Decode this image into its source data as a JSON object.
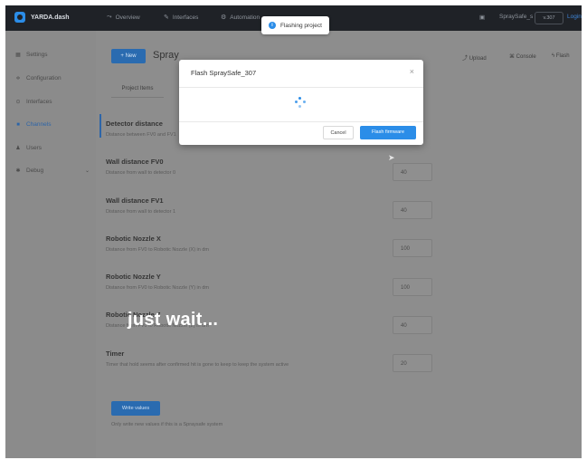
{
  "topbar": {
    "app_name": "YARDA.dash",
    "nav": [
      {
        "icon": "chart-line-icon",
        "label": "Overview"
      },
      {
        "icon": "pencil-icon",
        "label": "Interfaces"
      },
      {
        "icon": "gear-icon",
        "label": "Automation"
      }
    ],
    "user_label": "SpraySafe_s",
    "version_badge": "v.307",
    "login_label": "Login"
  },
  "toast": {
    "text": "Flashing project",
    "icon": "info-icon"
  },
  "sidebar": {
    "items": [
      {
        "icon": "grid-icon",
        "label": "Settings",
        "active": false
      },
      {
        "icon": "sliders-icon",
        "label": "Configuration",
        "active": false
      },
      {
        "icon": "plug-icon",
        "label": "Interfaces",
        "active": false
      },
      {
        "icon": "square-icon",
        "label": "Channels",
        "active": true
      },
      {
        "icon": "user-icon",
        "label": "Users",
        "active": false
      },
      {
        "icon": "bug-icon",
        "label": "Debug",
        "active": false
      }
    ]
  },
  "main": {
    "new_button": "+ New",
    "project_title": "Spray",
    "tools": [
      {
        "icon": "upload-icon",
        "label": "Upload"
      },
      {
        "icon": "terminal-icon",
        "label": "Console"
      },
      {
        "icon": "lightning-icon",
        "label": "Flash"
      }
    ],
    "tab_label": "Project Items",
    "fields": [
      {
        "title": "Detector distance",
        "desc": "Distance between FV0 and FV1",
        "value": ""
      },
      {
        "title": "Wall distance FV0",
        "desc": "Distance from wall to detector 0",
        "value": "40"
      },
      {
        "title": "Wall distance FV1",
        "desc": "Distance from wall to detector 1",
        "value": "40"
      },
      {
        "title": "Robotic Nozzle X",
        "desc": "Distance from FV0 to Robotic Nozzle (X) in dm",
        "value": "100"
      },
      {
        "title": "Robotic Nozzle Y",
        "desc": "Distance from FV0 to Robotic Nozzle (Y) in dm",
        "value": "100"
      },
      {
        "title": "Robotic Nozzle Z",
        "desc": "Distance from FV0 to Robotic Nozzle (Z) in dm",
        "value": "40"
      },
      {
        "title": "Timer",
        "desc": "Timer that hold seems after confirmed hit is gone to keep to keep the system active",
        "value": "20"
      }
    ],
    "write_button": "Write values",
    "footer_note": "Only write new values if this is a Spraysafe system"
  },
  "modal": {
    "title": "Flash SpraySafe_307",
    "cancel_label": "Cancel",
    "confirm_label": "Flash firmware"
  },
  "overlay_caption": "just wait..."
}
